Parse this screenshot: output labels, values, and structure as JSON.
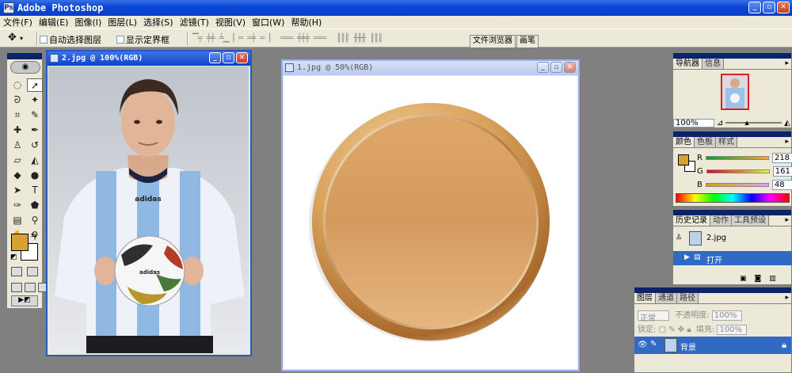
{
  "app": {
    "title": "Adobe Photoshop",
    "icon": "photoshop-icon"
  },
  "menu": [
    "文件(F)",
    "编辑(E)",
    "图像(I)",
    "图层(L)",
    "选择(S)",
    "滤镜(T)",
    "视图(V)",
    "窗口(W)",
    "帮助(H)"
  ],
  "options": {
    "auto_select": "自动选择图层",
    "show_bounds": "显示定界框"
  },
  "well_tabs": [
    "文件浏览器",
    "画笔"
  ],
  "tool_colors": {
    "foreground": "#d9a133",
    "background": "#ffffff"
  },
  "documents": [
    {
      "title": "2.jpg @ 100%(RGB)",
      "active": true
    },
    {
      "title": "1.jpg @ 50%(RGB)",
      "active": false
    }
  ],
  "navigator": {
    "tabs": [
      "导航器",
      "信息"
    ],
    "zoom": "100%"
  },
  "color": {
    "tabs": [
      "颜色",
      "色板",
      "样式"
    ],
    "channels": [
      {
        "name": "R",
        "value": "218"
      },
      {
        "name": "G",
        "value": "161"
      },
      {
        "name": "B",
        "value": "48"
      }
    ],
    "fill": "#d9a133"
  },
  "history": {
    "tabs": [
      "历史记录",
      "动作",
      "工具预设"
    ],
    "snapshot": "2.jpg",
    "step": "打开"
  },
  "layers": {
    "tabs": [
      "图层",
      "通道",
      "路径"
    ],
    "blend_mode": "正常",
    "opacity_label": "不透明度:",
    "opacity": "100%",
    "lock_label": "锁定:",
    "fill_label": "填充:",
    "fill": "100%",
    "layer_name": "背景"
  }
}
